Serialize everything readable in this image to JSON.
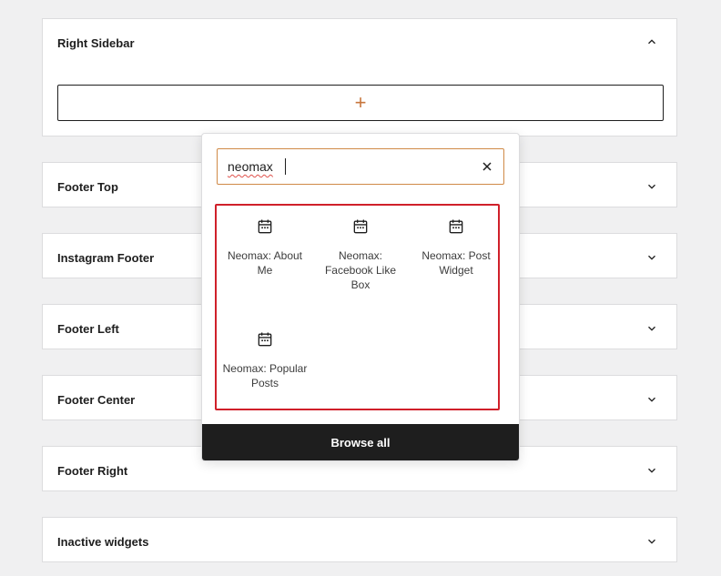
{
  "panels": {
    "right_sidebar": {
      "title": "Right Sidebar",
      "add_symbol": "+"
    },
    "footer_top": {
      "title": "Footer Top"
    },
    "instagram_footer": {
      "title": "Instagram Footer"
    },
    "footer_left": {
      "title": "Footer Left"
    },
    "footer_center": {
      "title": "Footer Center"
    },
    "footer_right": {
      "title": "Footer Right"
    },
    "inactive_widgets": {
      "title": "Inactive widgets"
    }
  },
  "inserter": {
    "search_value": "neomax",
    "results": [
      {
        "label": "Neomax: About Me",
        "icon": "calendar-icon"
      },
      {
        "label": "Neomax: Facebook Like Box",
        "icon": "calendar-icon"
      },
      {
        "label": "Neomax: Post Widget",
        "icon": "calendar-icon"
      },
      {
        "label": "Neomax: Popular Posts",
        "icon": "calendar-icon"
      }
    ],
    "browse_all_label": "Browse all"
  },
  "colors": {
    "accent_orange": "#c7763d",
    "highlight_red": "#d0202a",
    "dark_bar": "#1e1e1e"
  }
}
